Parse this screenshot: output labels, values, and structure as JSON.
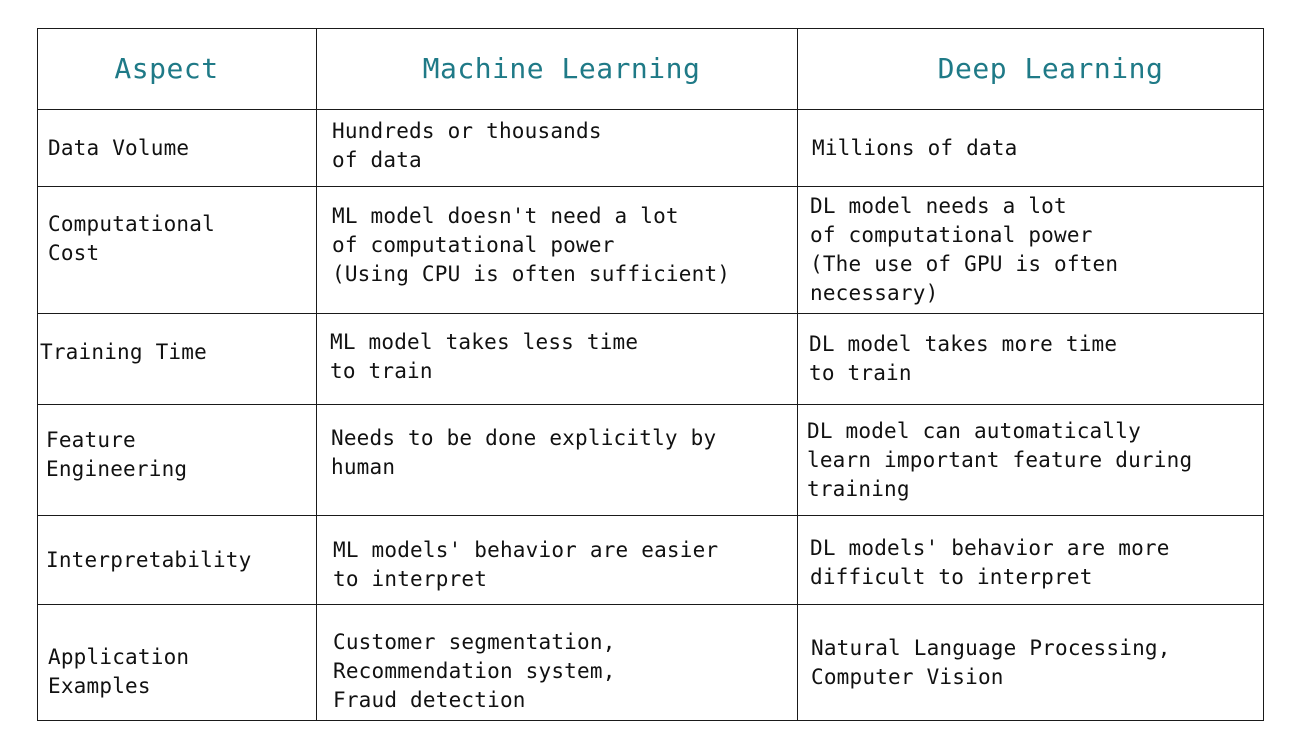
{
  "table": {
    "headers": {
      "aspect": "Aspect",
      "ml": "Machine Learning",
      "dl": "Deep Learning"
    },
    "rows": [
      {
        "aspect": "Data Volume",
        "ml": "Hundreds or thousands\nof data",
        "dl": "Millions of data"
      },
      {
        "aspect": "Computational\nCost",
        "ml": "ML model doesn't need a lot\nof computational power\n(Using CPU is often sufficient)",
        "dl": "DL model needs a lot\nof computational power\n(The use of GPU is often\nnecessary)"
      },
      {
        "aspect": "Training Time",
        "ml": "ML model takes less time\nto train",
        "dl": "DL model takes more time\nto train"
      },
      {
        "aspect": "Feature\nEngineering",
        "ml": "Needs to be done explicitly by\nhuman",
        "dl": "DL model can automatically\nlearn important feature during\ntraining"
      },
      {
        "aspect": "Interpretability",
        "ml": "ML models' behavior are easier\nto interpret",
        "dl": "DL models' behavior are more\ndifficult to interpret"
      },
      {
        "aspect": "Application\nExamples",
        "ml": "Customer segmentation,\nRecommendation system,\nFraud detection",
        "dl": "Natural Language Processing,\nComputer Vision"
      }
    ]
  },
  "colors": {
    "header_text": "#1f7a87",
    "body_text": "#111111",
    "border": "#1a1a1a"
  }
}
